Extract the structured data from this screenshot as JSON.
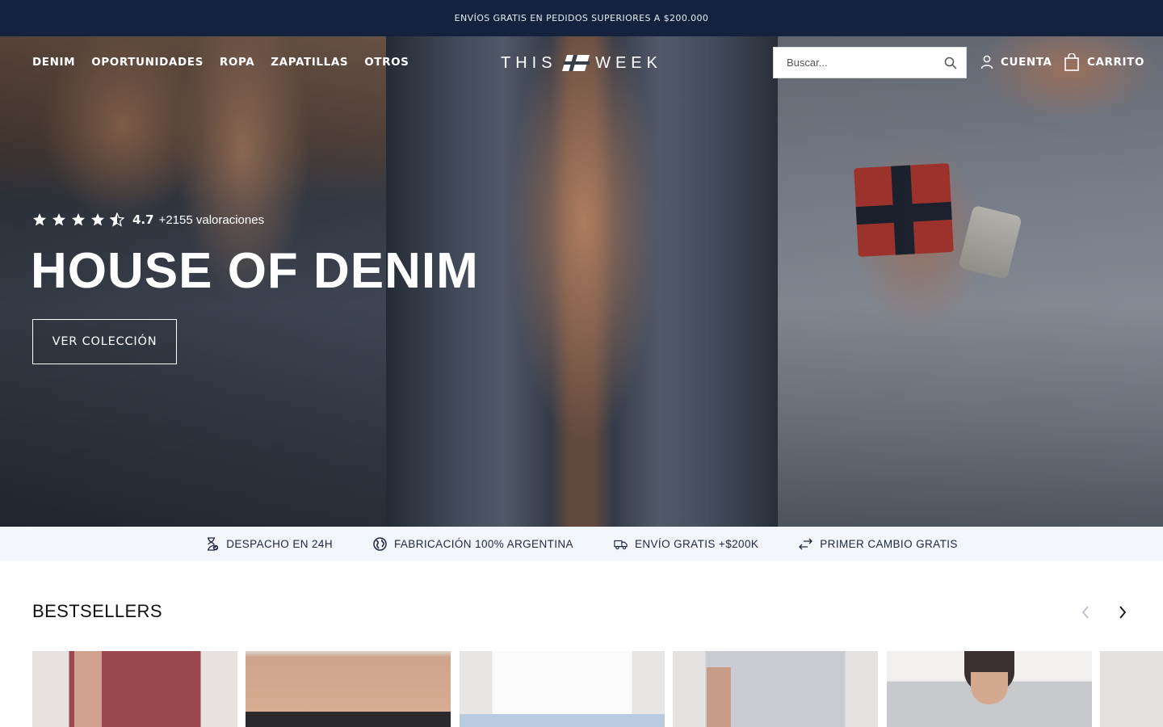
{
  "announcement": {
    "text": "ENVÍOS GRATIS EN PEDIDOS SUPERIORES A $200.000"
  },
  "header": {
    "nav": [
      "DENIM",
      "OPORTUNIDADES",
      "ROPA",
      "ZAPATILLAS",
      "OTROS"
    ],
    "logo": {
      "left": "THIS",
      "right": "WEEK"
    },
    "search": {
      "placeholder": "Buscar...",
      "value": ""
    },
    "account_label": "CUENTA",
    "cart_label": "CARRITO"
  },
  "hero": {
    "rating": {
      "stars": 4.5,
      "score": "4.7",
      "count": "+2155 valoraciones"
    },
    "title": "HOUSE OF DENIM",
    "cta_label": "VER COLECCIÓN"
  },
  "usp": [
    {
      "icon": "hourglass-icon",
      "label": "DESPACHO EN 24H"
    },
    {
      "icon": "globe-icon",
      "label": "FABRICACIÓN 100% ARGENTINA"
    },
    {
      "icon": "delivery-truck-icon",
      "label": "ENVÍO GRATIS +$200K"
    },
    {
      "icon": "exchange-arrows-icon",
      "label": "PRIMER CAMBIO GRATIS"
    }
  ],
  "bestsellers": {
    "title": "BESTSELLERS",
    "products": [
      {
        "kind": "burgundy-tshirt"
      },
      {
        "kind": "underwear"
      },
      {
        "kind": "white-tshirt"
      },
      {
        "kind": "grey-jeans"
      },
      {
        "kind": "grey-tshirt"
      },
      {
        "kind": "partial"
      }
    ]
  },
  "colors": {
    "announcement_bg": "#14223d",
    "usp_bg": "#f2f5f9",
    "text_dark": "#1c2740"
  }
}
